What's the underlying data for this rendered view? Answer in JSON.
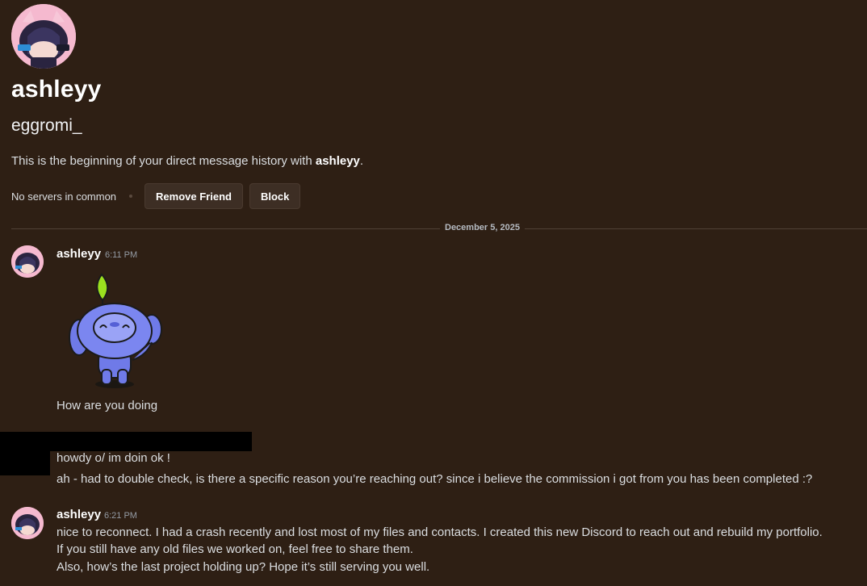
{
  "profile": {
    "display_name": "ashleyy",
    "username": "eggromi_",
    "intro_prefix": "This is the beginning of your direct message history with ",
    "intro_name": "ashleyy",
    "intro_suffix": ".",
    "mutual_servers": "No servers in common",
    "remove_friend_label": "Remove Friend",
    "block_label": "Block"
  },
  "date_divider": "December 5, 2025",
  "messages": [
    {
      "author": "ashleyy",
      "time": "6:11 PM",
      "sticker": "wumpus-wave-sticker",
      "text": "How are you doing"
    },
    {
      "author": "",
      "lines": [
        "howdy o/ im doin ok !",
        "ah - had to double check, is there a specific reason you’re reaching out? since i believe the commission i got from you has been completed :?"
      ]
    },
    {
      "author": "ashleyy",
      "time": "6:21 PM",
      "lines": [
        "nice to reconnect. I had a crash recently and lost most of my files and contacts. I created this new Discord  to reach out and rebuild my portfolio.",
        "If you still have any old files we worked on, feel free to share them.",
        "Also, how’s the last project holding up? Hope it’s still serving you well."
      ]
    }
  ],
  "colors": {
    "background": "#2e1f14",
    "button_bg": "#3d2e24",
    "text": "#dbdee1",
    "muted": "#949ba4"
  }
}
